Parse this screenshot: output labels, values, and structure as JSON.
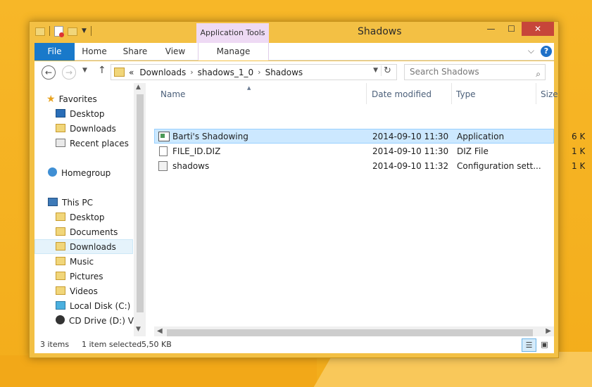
{
  "window": {
    "title": "Shadows",
    "context_tab": "Application Tools",
    "buttons": {
      "minimize": "—",
      "maximize": "☐",
      "close": "✕"
    }
  },
  "ribbon": {
    "tabs": [
      "File",
      "Home",
      "Share",
      "View",
      "Manage"
    ]
  },
  "address": {
    "overflow": "«",
    "path": [
      "Downloads",
      "shadows_1_0",
      "Shadows"
    ]
  },
  "search": {
    "placeholder": "Search Shadows"
  },
  "nav_pane": {
    "favorites_label": "Favorites",
    "favorites": [
      "Desktop",
      "Downloads",
      "Recent places"
    ],
    "homegroup_label": "Homegroup",
    "thispc_label": "This PC",
    "thispc": [
      "Desktop",
      "Documents",
      "Downloads",
      "Music",
      "Pictures",
      "Videos",
      "Local Disk (C:)",
      "CD Drive (D:) Virt"
    ],
    "selected": "Downloads"
  },
  "file_list": {
    "columns": [
      "Name",
      "Date modified",
      "Type",
      "Size"
    ],
    "rows": [
      {
        "name": "Barti's Shadowing",
        "date": "2014-09-10 11:30",
        "type": "Application",
        "size": "6 K",
        "icon": "application-icon",
        "selected": true
      },
      {
        "name": "FILE_ID.DIZ",
        "date": "2014-09-10 11:30",
        "type": "DIZ File",
        "size": "1 K",
        "icon": "text-file-icon",
        "selected": false
      },
      {
        "name": "shadows",
        "date": "2014-09-10 11:32",
        "type": "Configuration sett...",
        "size": "1 K",
        "icon": "config-file-icon",
        "selected": false
      }
    ]
  },
  "status": {
    "item_count": "3 items",
    "selection": "1 item selected",
    "size": "5,50 KB"
  },
  "colors": {
    "desktop": "#f4b11c",
    "file_tab": "#1979ca",
    "close_button": "#c7463a",
    "selection": "#cce8ff"
  }
}
